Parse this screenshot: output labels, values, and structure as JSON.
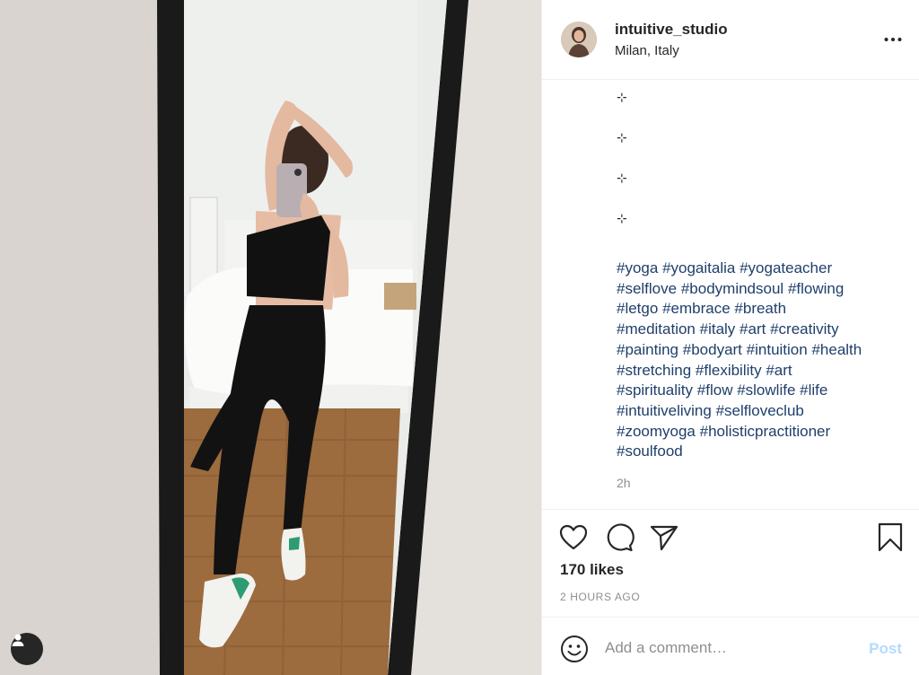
{
  "post": {
    "username": "intuitive_studio",
    "location": "Milan, Italy",
    "caption_sparkles": [
      "⊹",
      "⊹",
      "⊹",
      "⊹"
    ],
    "hashtag_lines": [
      [
        "#yoga",
        "#yogaitalia",
        "#yogateacher"
      ],
      [
        "#selflove",
        "#bodymindsoul",
        "#flowing"
      ],
      [
        "#letgo",
        "#embrace",
        "#breath"
      ],
      [
        "#meditation",
        "#italy",
        "#art",
        "#creativity"
      ],
      [
        "#painting",
        "#bodyart",
        "#intuition",
        "#health"
      ],
      [
        "#stretching",
        "#flexibility",
        "#art"
      ],
      [
        "#spirituality",
        "#flow",
        "#slowlife",
        "#life"
      ],
      [
        "#intuitiveliving",
        "#selfloveclub"
      ],
      [
        "#zoomyoga",
        "#holisticpractitioner"
      ],
      [
        "#soulfood"
      ]
    ],
    "caption_time": "2h",
    "likes": "170 likes",
    "posted_ago": "2 HOURS AGO"
  },
  "comment": {
    "placeholder": "Add a comment…",
    "post_label": "Post"
  },
  "icons": {
    "more": "more-options-icon",
    "like": "heart-icon",
    "comment": "comment-icon",
    "share": "paper-plane-icon",
    "save": "bookmark-icon",
    "emoji": "smiley-icon",
    "tags": "user-tag-icon"
  },
  "colors": {
    "hashtag": "#1f3f6b",
    "post_button_disabled": "#b3dbff",
    "secondary_text": "#8e8e8e",
    "divider": "#efefef"
  }
}
